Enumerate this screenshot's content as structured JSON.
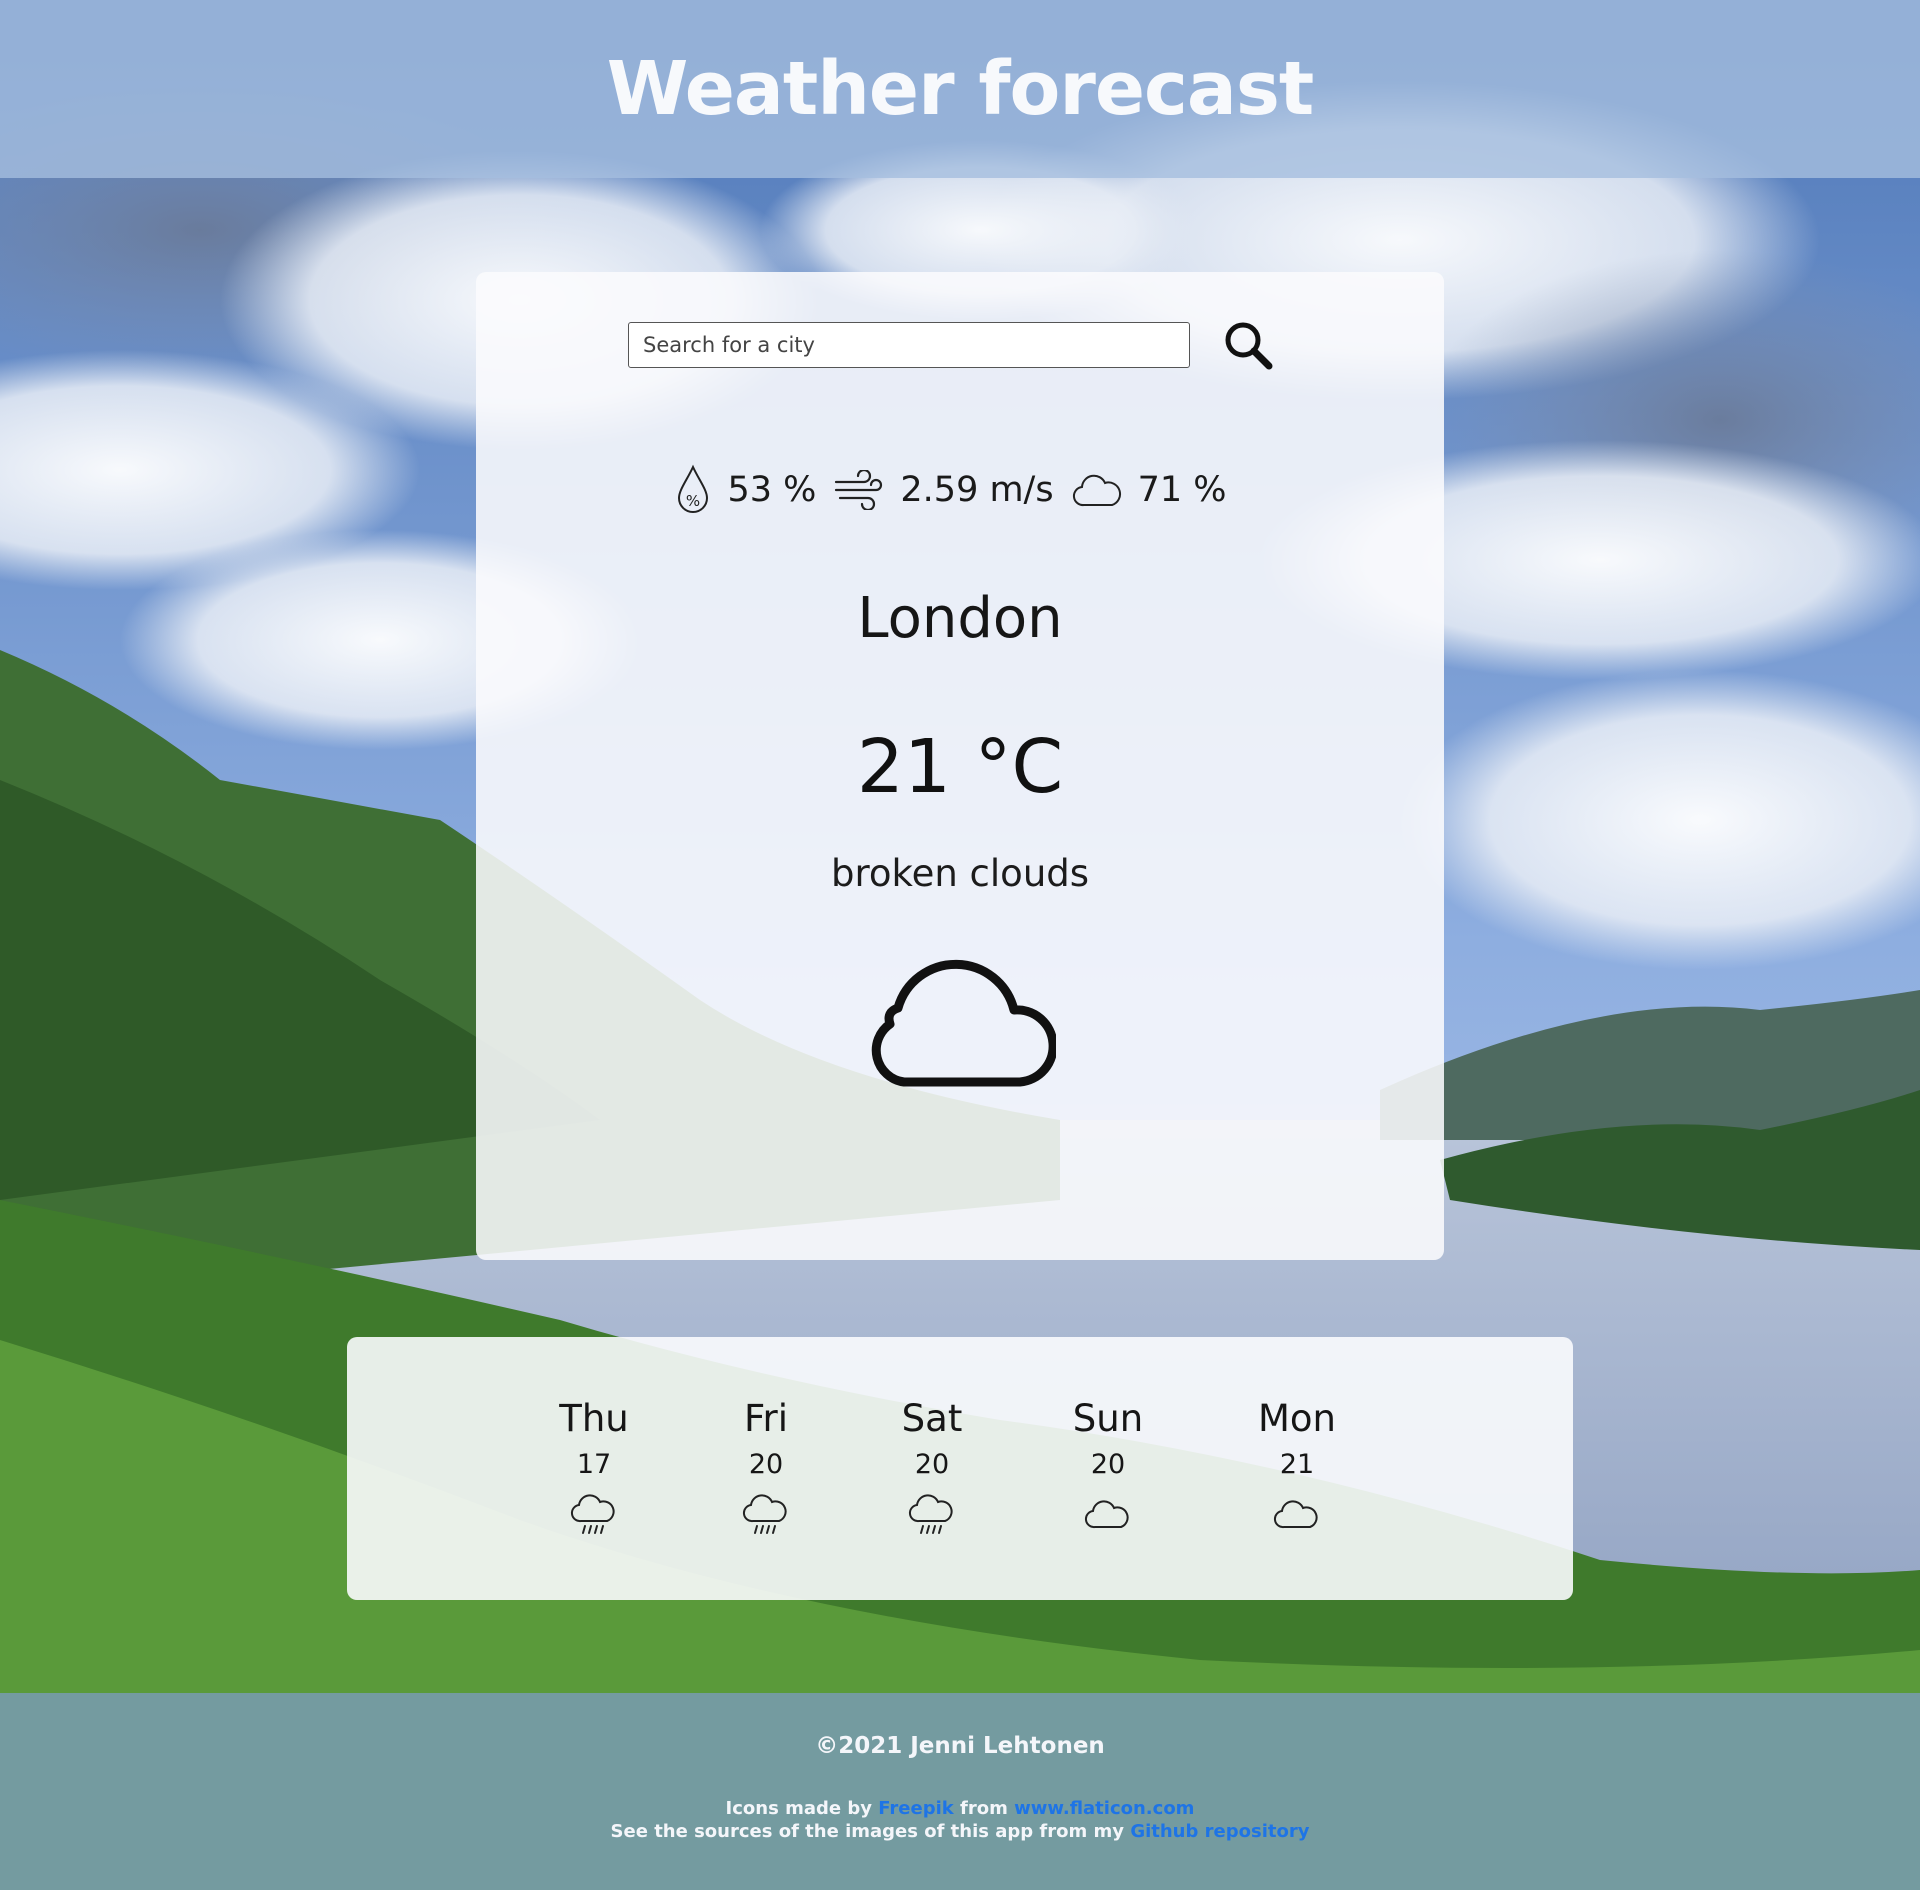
{
  "header": {
    "title": "Weather forecast"
  },
  "search": {
    "placeholder": "Search for a city",
    "button_icon": "search-icon"
  },
  "current": {
    "humidity": {
      "icon": "humidity-icon",
      "value": "53 %"
    },
    "wind": {
      "icon": "wind-icon",
      "value": "2.59 m/s"
    },
    "clouds": {
      "icon": "cloud-icon",
      "value": "71 %"
    },
    "city": "London",
    "temperature": "21 °C",
    "description": "broken clouds",
    "icon": "cloud-icon"
  },
  "forecast": [
    {
      "day": "Thu",
      "temp": "17",
      "icon": "rain-icon"
    },
    {
      "day": "Fri",
      "temp": "20",
      "icon": "rain-icon"
    },
    {
      "day": "Sat",
      "temp": "20",
      "icon": "rain-icon"
    },
    {
      "day": "Sun",
      "temp": "20",
      "icon": "cloud-icon"
    },
    {
      "day": "Mon",
      "temp": "21",
      "icon": "cloud-icon"
    }
  ],
  "footer": {
    "copyright": "©2021 Jenni Lehtonen",
    "icons_prefix": "Icons made by",
    "icons_author": "Freepik",
    "icons_from": "from",
    "icons_site": "www.flaticon.com",
    "sources_text": "See the sources of the images of this app from my",
    "sources_link": "Github repository"
  },
  "colors": {
    "link": "#1e74e6",
    "text": "#161616",
    "header_text": "#f7f9fc"
  }
}
